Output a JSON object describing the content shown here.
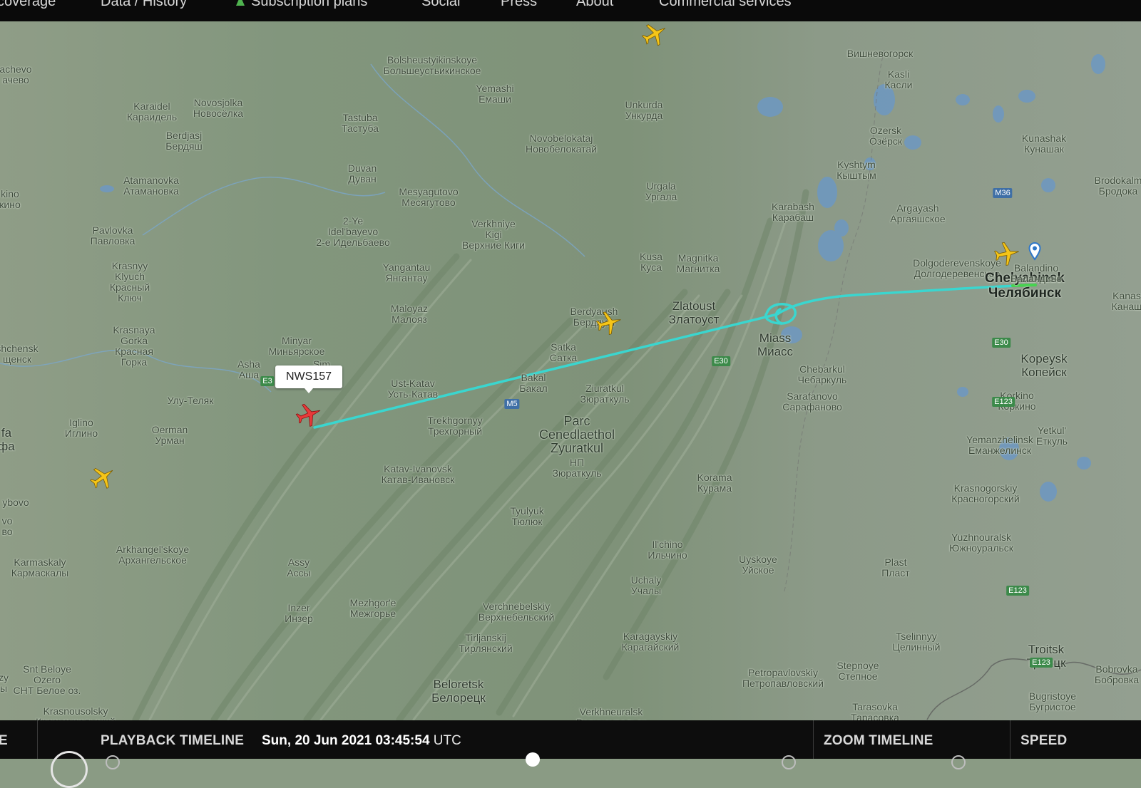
{
  "nav": {
    "items": [
      "coverage",
      "Data / History",
      "Subscription plans",
      "Social",
      "Press",
      "About",
      "Commercial services"
    ]
  },
  "map": {
    "flight_label": "NWS157",
    "labels": [
      {
        "lines": [
          "Bolsheustyikinskoye",
          "Большеустьикинское"
        ]
      },
      {
        "lines": [
          "Вишневогорск"
        ]
      },
      {
        "lines": [
          "Kasli",
          "Касли"
        ]
      },
      {
        "lines": [
          "achevo",
          "ачево"
        ]
      },
      {
        "lines": [
          "Yemashi",
          "Емаши"
        ]
      },
      {
        "lines": [
          "Karaidel",
          "Караидель"
        ]
      },
      {
        "lines": [
          "Novosjolka",
          "Новосёлка"
        ]
      },
      {
        "lines": [
          "Unkurda",
          "Ункурда"
        ]
      },
      {
        "lines": [
          "Tastuba",
          "Тастуба"
        ]
      },
      {
        "lines": [
          "Ozersk",
          "Озёрск"
        ]
      },
      {
        "lines": [
          "Berdjasj",
          "Бердяш"
        ]
      },
      {
        "lines": [
          "Novobelokataj",
          "Новобелокатай"
        ]
      },
      {
        "lines": [
          "Kunashak",
          "Кунашак"
        ]
      },
      {
        "lines": [
          "Duvan",
          "Дуван"
        ]
      },
      {
        "lines": [
          "Kyshtym",
          "Кыштым"
        ]
      },
      {
        "lines": [
          "Atamanovka",
          "Атамановка"
        ]
      },
      {
        "lines": [
          "Brodokalm",
          "Бродока"
        ]
      },
      {
        "lines": [
          "Urgala",
          "Ургала"
        ]
      },
      {
        "lines": [
          "Mesyagutovo",
          "Месягутово"
        ]
      },
      {
        "lines": [
          "kino",
          "кино"
        ]
      },
      {
        "lines": [
          "Karabash",
          "Карабаш"
        ]
      },
      {
        "lines": [
          "Argayash",
          "Аргаяшское"
        ]
      },
      {
        "lines": [
          "2-Ye",
          "Idel'bayevo",
          "2-е Идельбаево"
        ]
      },
      {
        "lines": [
          "Verkhniye",
          "Kigi",
          "Верхние Киги"
        ]
      },
      {
        "lines": [
          "Pavlovka",
          "Павловка"
        ]
      },
      {
        "lines": [
          "Kusa",
          "Куса"
        ]
      },
      {
        "lines": [
          "Magnitka",
          "Магнитка"
        ]
      },
      {
        "lines": [
          "Dolgoderevenskoye",
          "Долгодеревенское"
        ]
      },
      {
        "lines": [
          "Yangantau",
          "Янгантау"
        ]
      },
      {
        "lines": [
          "Krasnyy",
          "Klyuch",
          "Красный",
          "Ключ"
        ]
      },
      {
        "lines": [
          "Kanas",
          "Канаш"
        ]
      },
      {
        "lines": [
          "Maloyaz",
          "Малояз"
        ]
      },
      {
        "lines": [
          "Zlatoust",
          "Златоуст"
        ],
        "cls": "town"
      },
      {
        "lines": [
          "Berdyaush",
          "Бердяуш"
        ]
      },
      {
        "lines": [
          "Krasnaya",
          "Gorka",
          "Красная",
          "Горка"
        ]
      },
      {
        "lines": [
          "Miass",
          "Миасс"
        ],
        "cls": "town"
      },
      {
        "lines": [
          "Minyar",
          "Миньярское"
        ]
      },
      {
        "lines": [
          "Satka",
          "Сатка"
        ]
      },
      {
        "lines": [
          "shchensk",
          "щенск"
        ]
      },
      {
        "lines": [
          "Kopeysk",
          "Копейск"
        ],
        "cls": "town"
      },
      {
        "lines": [
          "Asha",
          "Аша"
        ]
      },
      {
        "lines": [
          "Sim",
          "Сим"
        ]
      },
      {
        "lines": [
          "Chebarkul",
          "Чебаркуль"
        ]
      },
      {
        "lines": [
          "Bakal",
          "Бакал"
        ]
      },
      {
        "lines": [
          "Ust-Katav",
          "Усть-Катав"
        ]
      },
      {
        "lines": [
          "Ziuratkul",
          "Зюраткуль"
        ]
      },
      {
        "lines": [
          "Улу-Теляк"
        ]
      },
      {
        "lines": [
          "Korkino",
          "Коркино"
        ]
      },
      {
        "lines": [
          "Sarafanovo",
          "Сарафаново"
        ]
      },
      {
        "lines": [
          "Trekhgornyy",
          "Трехгорный"
        ]
      },
      {
        "lines": [
          "Iglino",
          "Иглино"
        ]
      },
      {
        "lines": [
          "Oerman",
          "Урман"
        ]
      },
      {
        "lines": [
          "Yemanzhelinsk",
          "Еманжелинск"
        ]
      },
      {
        "lines": [
          "Yetkul'",
          "Еткуль"
        ]
      },
      {
        "lines": [
          "Katav-Ivanovsk",
          "Катав-Ивановск"
        ]
      },
      {
        "lines": [
          "Korama",
          "Курама"
        ]
      },
      {
        "lines": [
          "Krasnogorskiy",
          "Красногорский"
        ]
      },
      {
        "lines": [
          "ybovo"
        ]
      },
      {
        "lines": [
          "Tyulyuk",
          "Тюлюк"
        ]
      },
      {
        "lines": [
          "Yuzhnouralsk",
          "Южноуральск"
        ]
      },
      {
        "lines": [
          "vo",
          "во"
        ]
      },
      {
        "lines": [
          "Arkhangel'skoye",
          "Архангельское"
        ]
      },
      {
        "lines": [
          "Il'chino",
          "Ильчино"
        ]
      },
      {
        "lines": [
          "Karmaskaly",
          "Кармаскалы"
        ]
      },
      {
        "lines": [
          "Assy",
          "Ассы"
        ]
      },
      {
        "lines": [
          "Uyskoye",
          "Уйское"
        ]
      },
      {
        "lines": [
          "Plast",
          "Пласт"
        ]
      },
      {
        "lines": [
          "Uchaly",
          "Учалы"
        ]
      },
      {
        "lines": [
          "Inzer",
          "Инзер"
        ]
      },
      {
        "lines": [
          "Verchnebelskiy",
          "Верхнебельский"
        ]
      },
      {
        "lines": [
          "Mezhgor'e",
          "Межгорье"
        ]
      },
      {
        "lines": [
          "Tirljanskij",
          "Тирлянский"
        ]
      },
      {
        "lines": [
          "Karagayskiy",
          "Карагайский"
        ]
      },
      {
        "lines": [
          "Tselinnyy",
          "Целинный"
        ]
      },
      {
        "lines": [
          "Troitsk",
          "Троицк"
        ],
        "cls": "town"
      },
      {
        "lines": [
          "Snt Beloye",
          "Ozero",
          "СНТ Белое оз."
        ]
      },
      {
        "lines": [
          "Petropavlovskiy",
          "Петропавловский"
        ]
      },
      {
        "lines": [
          "Stepnoye",
          "Степное"
        ]
      },
      {
        "lines": [
          "Bobrovka",
          "Бобровка"
        ]
      },
      {
        "lines": [
          "Beloretsk",
          "Белорецк"
        ],
        "cls": "town"
      },
      {
        "lines": [
          "Bugristoye",
          "Бугристое"
        ]
      },
      {
        "lines": [
          "Tarasovka",
          "Тарасовка"
        ]
      },
      {
        "lines": [
          "Krasnousolsky",
          "Красноусольский"
        ]
      },
      {
        "lines": [
          "Verkhneuralsk",
          "Верхнеуральск"
        ]
      },
      {
        "lines": [
          "Chelyabinsk",
          "Челябинск"
        ],
        "cls": "city"
      },
      {
        "lines": [
          "Balandino",
          "Баландино"
        ]
      },
      {
        "lines": [
          "Parc",
          "Cenedlaethol",
          "Zyuratkul"
        ],
        "cls": "park"
      },
      {
        "lines": [
          "НП",
          "Зюраткуль"
        ]
      },
      {
        "lines": [
          "fa",
          "фа"
        ],
        "cls": "town"
      },
      {
        "lines": [
          "zy",
          "ы"
        ]
      }
    ],
    "shields": [
      {
        "text": "M36",
        "color": "blue"
      },
      {
        "text": "M5",
        "color": "blue"
      },
      {
        "text": "E30",
        "color": "green"
      },
      {
        "text": "E30",
        "color": "green"
      },
      {
        "text": "E123",
        "color": "green"
      },
      {
        "text": "E123",
        "color": "green"
      },
      {
        "text": "E123",
        "color": "green"
      },
      {
        "text": "E3",
        "color": "green"
      }
    ]
  },
  "timeline": {
    "side_label": "E",
    "playback_label": "PLAYBACK TIMELINE",
    "datetime": "Sun, 20 Jun 2021 03:45:54",
    "timezone": "UTC",
    "zoom_label": "ZOOM TIMELINE",
    "speed_label": "SPEED"
  },
  "colors": {
    "track": "#3ad6cf",
    "selected_plane": "#e83a3a",
    "other_planes": "#f5c518",
    "nav_bg": "#0a0a0a"
  },
  "icons": [
    "airplane-icon",
    "map-pin-icon",
    "tree-icon",
    "play-icon"
  ]
}
